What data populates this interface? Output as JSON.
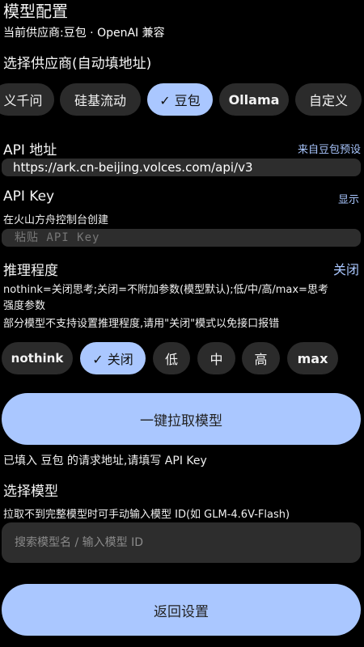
{
  "header": {
    "title": "模型配置",
    "subtitle": "当前供应商:豆包 · OpenAI 兼容"
  },
  "provider_section": {
    "title": "选择供应商(自动填地址)",
    "chips": [
      {
        "label": "义千问",
        "selected": false
      },
      {
        "label": "硅基流动",
        "selected": false
      },
      {
        "label": "✓ 豆包",
        "selected": true
      },
      {
        "label": "Ollama",
        "selected": false
      },
      {
        "label": "自定义",
        "selected": false
      }
    ]
  },
  "api_url": {
    "label": "API 地址",
    "preset_link": "来自豆包预设",
    "value": "https://ark.cn-beijing.volces.com/api/v3"
  },
  "api_key": {
    "label": "API Key",
    "show_link": "显示",
    "hint": "在火山方舟控制台创建",
    "placeholder": "粘贴 API Key"
  },
  "reasoning": {
    "title": "推理程度",
    "current": "关闭",
    "desc1": "nothink=关闭思考;关闭=不附加参数(模型默认);低/中/高/max=思考",
    "desc2": "强度参数",
    "note": "部分模型不支持设置推理程度,请用\"关闭\"模式以免接口报错",
    "chips": [
      {
        "label": "nothink",
        "selected": false
      },
      {
        "label": "✓ 关闭",
        "selected": true
      },
      {
        "label": "低",
        "selected": false
      },
      {
        "label": "中",
        "selected": false
      },
      {
        "label": "高",
        "selected": false
      },
      {
        "label": "max",
        "selected": false
      }
    ]
  },
  "fetch_button": {
    "label": "一键拉取模型",
    "status": "已填入 豆包 的请求地址,请填写 API Key"
  },
  "model_section": {
    "title": "选择模型",
    "hint": "拉取不到完整模型时可手动输入模型 ID(如 GLM-4.6V-Flash)",
    "search_placeholder": "搜索模型名 / 输入模型 ID"
  },
  "back_button": {
    "label": "返回设置"
  },
  "colors": {
    "accent": "#aac7ff",
    "chip_bg": "#2b2b2b",
    "field_bg": "#2d2d2d",
    "background": "#000000"
  }
}
